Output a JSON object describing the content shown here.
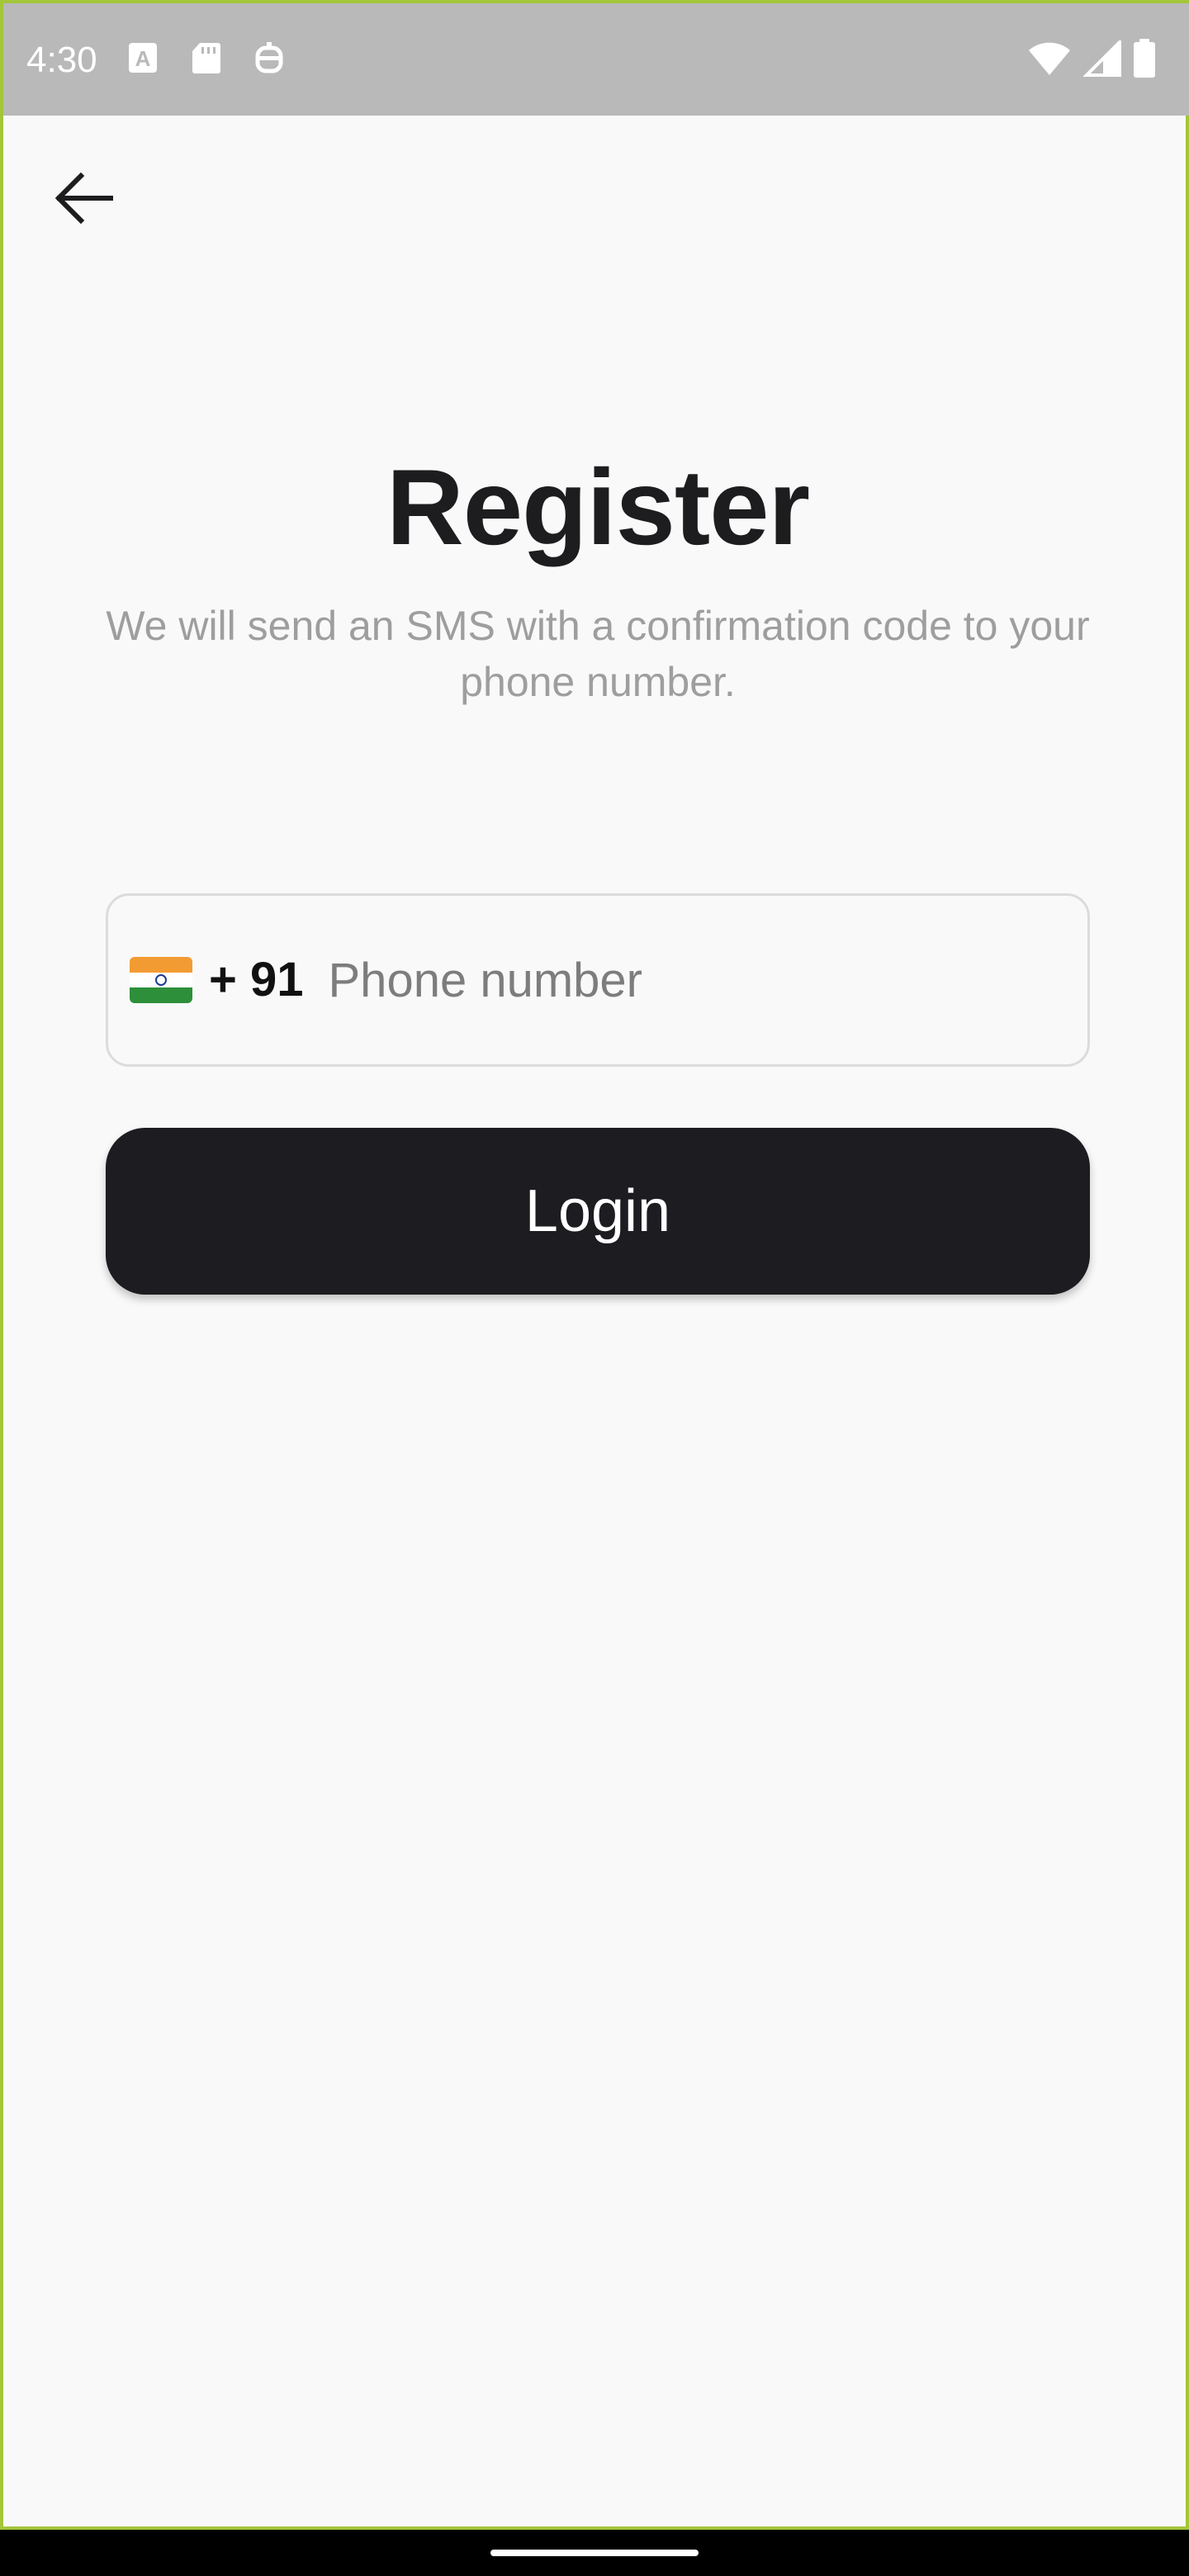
{
  "status_bar": {
    "time": "4:30",
    "left_icons": [
      "app-a-icon",
      "sd-card-icon",
      "robot-icon"
    ],
    "right_icons": [
      "wifi-icon",
      "cell-signal-icon",
      "battery-icon"
    ],
    "background": "#b9b9b9"
  },
  "header": {
    "back_icon": "arrow-left-icon"
  },
  "main": {
    "title": "Register",
    "subtitle": "We will send an SMS with a confirmation code to your phone number.",
    "phone": {
      "country_flag": "india-flag-icon",
      "dial_code": "+ 91",
      "placeholder": "Phone number",
      "value": ""
    },
    "login_button": {
      "label": "Login",
      "color": "#1c1c21"
    }
  },
  "colors": {
    "background": "#f9f9f9",
    "title": "#1d1d1f",
    "subtitle": "#9e9e9e",
    "field_border": "#dcdcdc",
    "button": "#1c1c21"
  }
}
